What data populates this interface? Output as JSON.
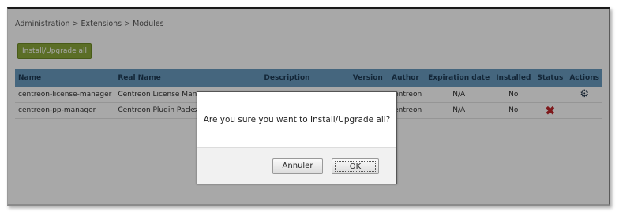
{
  "breadcrumb": "Administration  >  Extensions  >  Modules",
  "install_all_label": "Install/Upgrade all",
  "table": {
    "headers": [
      "Name",
      "Real Name",
      "Description",
      "Version",
      "Author",
      "Expiration date",
      "Installed",
      "Status",
      "Actions"
    ],
    "rows": [
      {
        "name": "centreon-license-manager",
        "real_name": "Centreon License Manage",
        "description": "",
        "version": "",
        "author": "Centreon",
        "expiration": "N/A",
        "installed": "No",
        "status_icon": "",
        "action_icon": "gear-icon"
      },
      {
        "name": "centreon-pp-manager",
        "real_name": "Centreon Plugin Packs Ma",
        "description": "",
        "version": "",
        "author": "Centreon",
        "expiration": "N/A",
        "installed": "No",
        "status_icon": "x-icon",
        "action_icon": ""
      }
    ]
  },
  "dialog": {
    "message": "Are you sure you want to Install/Upgrade all?",
    "cancel_label": "Annuler",
    "ok_label": "OK"
  },
  "colors": {
    "header_bg": "#6a9cbf",
    "install_button": "#8aa83a",
    "status_error": "#c0262b"
  }
}
